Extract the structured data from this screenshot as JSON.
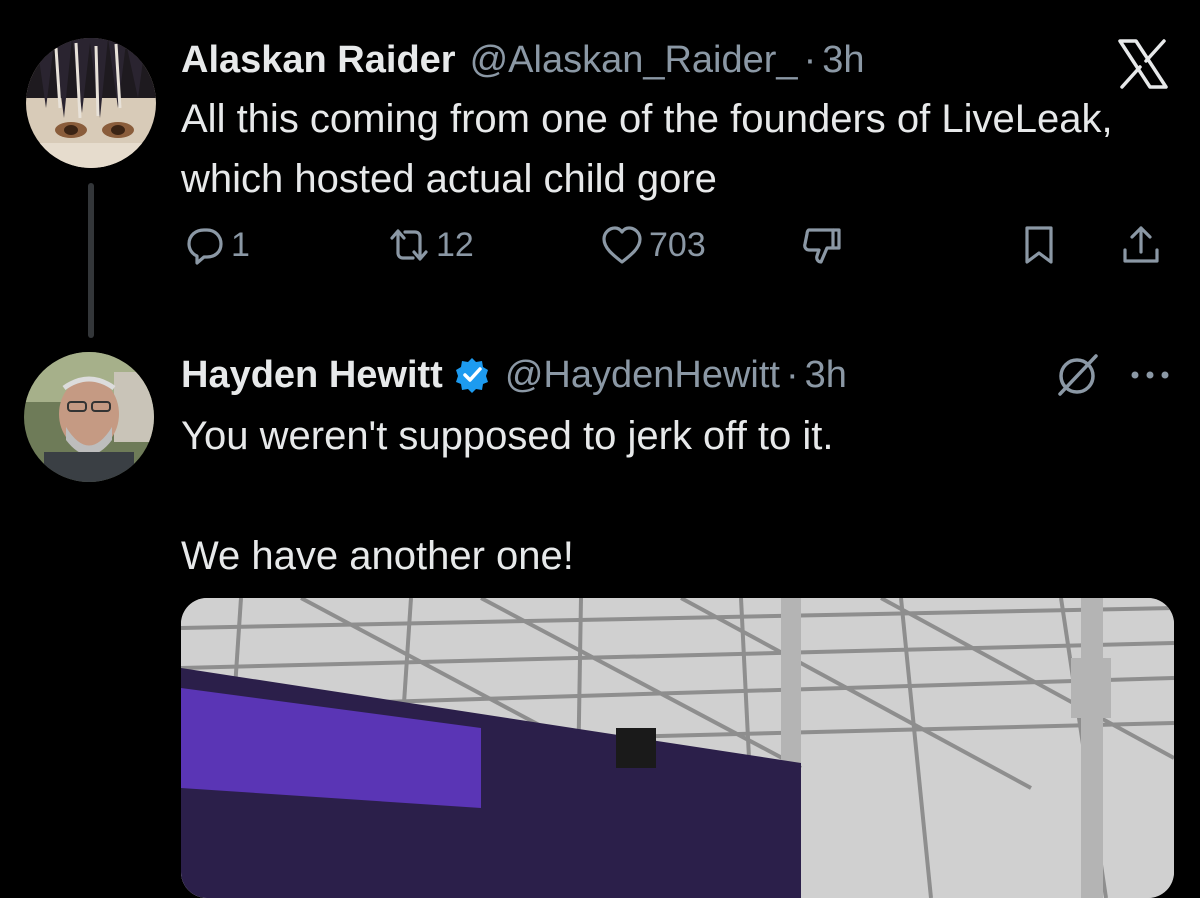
{
  "tweets": [
    {
      "author_name": "Alaskan Raider",
      "handle": "@Alaskan_Raider_",
      "separator": "·",
      "time": "3h",
      "text": "All this coming from one of the founders of LiveLeak, which hosted actual child gore",
      "metrics": {
        "replies": "1",
        "retweets": "12",
        "likes": "703"
      }
    },
    {
      "author_name": "Hayden Hewitt",
      "handle": "@HaydenHewitt",
      "separator": "·",
      "time": "3h",
      "text": "You weren't supposed to jerk off to it.\n\nWe have another one!",
      "verified": true
    }
  ],
  "icons": {
    "reply": "reply-icon",
    "retweet": "retweet-icon",
    "like": "heart-icon",
    "dislike": "dislike-icon",
    "bookmark": "bookmark-icon",
    "share": "share-icon",
    "brand": "x-logo-icon",
    "grok": "grok-icon",
    "more": "more-icon",
    "verified": "verified-badge-icon"
  },
  "colors": {
    "background": "#000000",
    "text_primary": "#e7e9ea",
    "text_secondary": "#8b98a5",
    "verified_blue": "#1d9bf0",
    "thread_line": "#333639"
  }
}
